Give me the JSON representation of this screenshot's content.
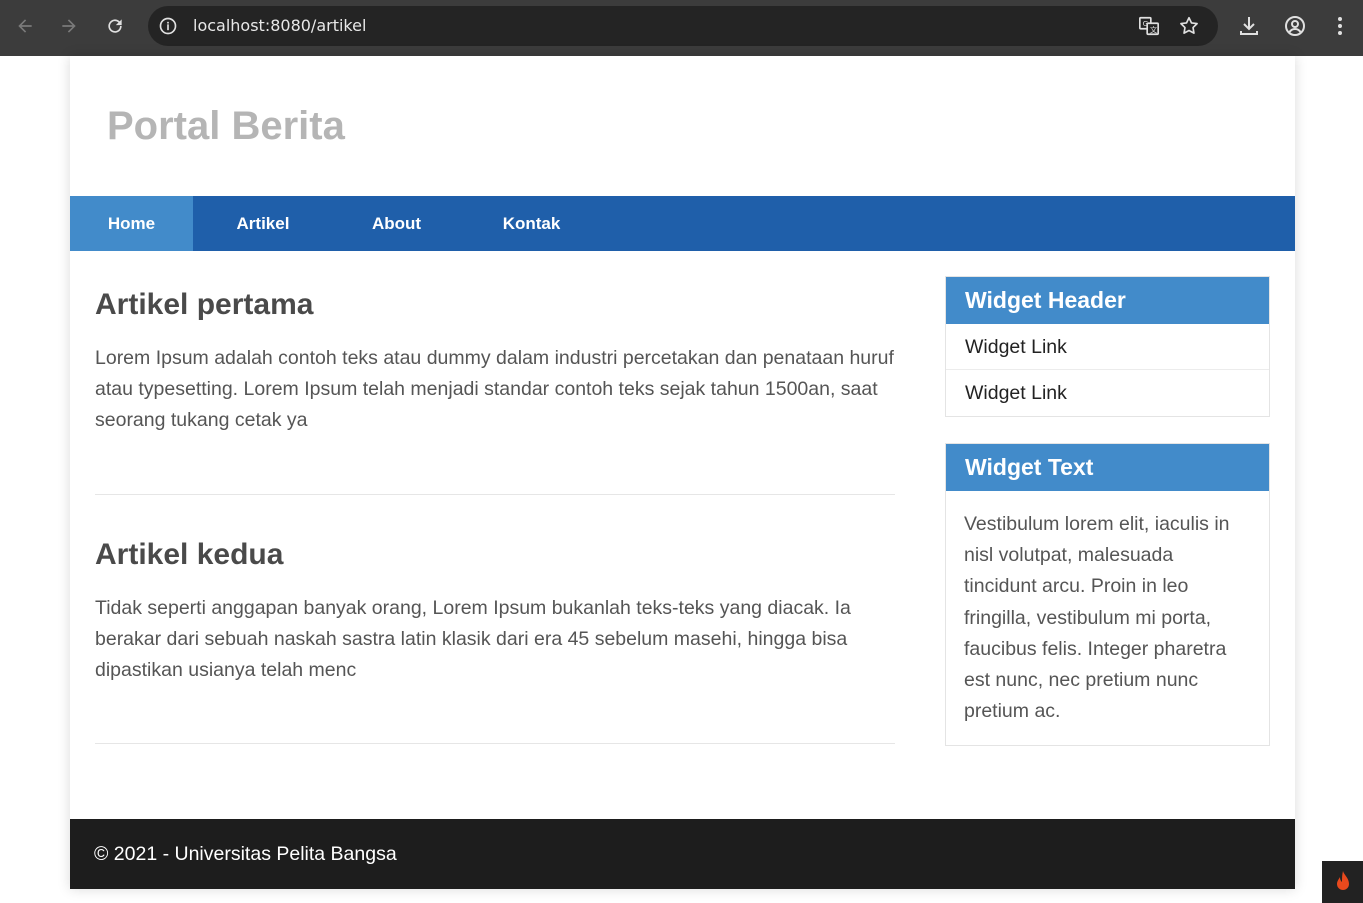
{
  "browser": {
    "url": "localhost:8080/artikel",
    "icons": [
      "back-icon",
      "forward-icon",
      "reload-icon",
      "info-icon",
      "translate-icon",
      "star-icon",
      "download-icon",
      "account-icon",
      "menu-icon"
    ]
  },
  "site": {
    "title": "Portal Berita"
  },
  "nav": {
    "items": [
      {
        "label": "Home",
        "active": true
      },
      {
        "label": "Artikel",
        "active": false
      },
      {
        "label": "About",
        "active": false
      },
      {
        "label": "Kontak",
        "active": false
      }
    ]
  },
  "articles": [
    {
      "title": "Artikel pertama",
      "body": "Lorem Ipsum adalah contoh teks atau dummy dalam industri percetakan dan penataan huruf atau typesetting. Lorem Ipsum telah menjadi standar contoh teks sejak tahun 1500an, saat seorang tukang cetak ya"
    },
    {
      "title": "Artikel kedua",
      "body": "Tidak seperti anggapan banyak orang, Lorem Ipsum bukanlah teks-teks yang diacak. Ia berakar dari sebuah naskah sastra latin klasik dari era 45 sebelum masehi, hingga bisa dipastikan usianya telah menc"
    }
  ],
  "sidebar": {
    "widget1": {
      "header": "Widget Header",
      "links": [
        "Widget Link",
        "Widget Link"
      ]
    },
    "widget2": {
      "header": "Widget Text",
      "text": "Vestibulum lorem elit, iaculis in nisl volutpat, malesuada tincidunt arcu. Proin in leo fringilla, vestibulum mi porta, faucibus felis. Integer pharetra est nunc, nec pretium nunc pretium ac."
    }
  },
  "footer": {
    "text": "© 2021 - Universitas Pelita Bangsa"
  },
  "colors": {
    "nav_bg": "#1f5faa",
    "nav_active": "#428bca",
    "widget_header": "#428bca",
    "footer_bg": "#1d1d1d"
  }
}
